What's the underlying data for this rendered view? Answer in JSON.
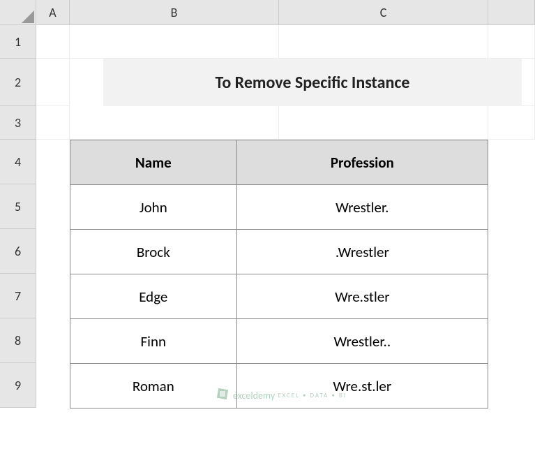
{
  "columns": [
    "A",
    "B",
    "C"
  ],
  "rows": [
    "1",
    "2",
    "3",
    "4",
    "5",
    "6",
    "7",
    "8",
    "9"
  ],
  "title": "To Remove Specific Instance",
  "chart_data": {
    "type": "table",
    "headers": [
      "Name",
      "Profession"
    ],
    "rows": [
      [
        "John",
        "Wrestler."
      ],
      [
        "Brock",
        ".Wrestler"
      ],
      [
        "Edge",
        "Wre.stler"
      ],
      [
        "Finn",
        "Wrestler.."
      ],
      [
        "Roman",
        "Wre.st.ler"
      ]
    ]
  },
  "watermark": {
    "brand": "exceldemy",
    "tagline": "EXCEL • DATA • BI"
  }
}
